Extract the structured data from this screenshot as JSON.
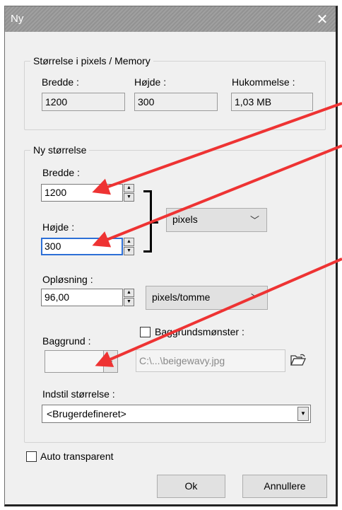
{
  "window": {
    "title": "Ny",
    "close_glyph": "✕"
  },
  "size_group": {
    "legend": "Størrelse i pixels / Memory",
    "width_label": "Bredde :",
    "width_value": "1200",
    "height_label": "Højde :",
    "height_value": "300",
    "memory_label": "Hukommelse :",
    "memory_value": "1,03 MB"
  },
  "new_size_group": {
    "legend": "Ny størrelse",
    "width_label": "Bredde :",
    "width_value": "1200",
    "height_label": "Højde :",
    "height_value": "300",
    "unit_value": "pixels",
    "resolution_label": "Opløsning :",
    "resolution_value": "96,00",
    "resolution_unit": "pixels/tomme",
    "background_label": "Baggrund :",
    "pattern_label": "Baggrundsmønster :",
    "pattern_path": "C:\\...\\beigewavy.jpg",
    "preset_label": "Indstil størrelse :",
    "preset_value": "<Brugerdefineret>"
  },
  "auto_transparent_label": "Auto transparent",
  "buttons": {
    "ok": "Ok",
    "cancel": "Annullere"
  },
  "icons": {
    "close": "close-icon",
    "spin_up": "▲",
    "spin_down": "▼",
    "dropdown": "▼",
    "chevron": "﹀",
    "folder": "folder-open-icon"
  },
  "colors": {
    "annotation_arrow": "#ee3333",
    "focus_border": "#2d6fd6"
  }
}
